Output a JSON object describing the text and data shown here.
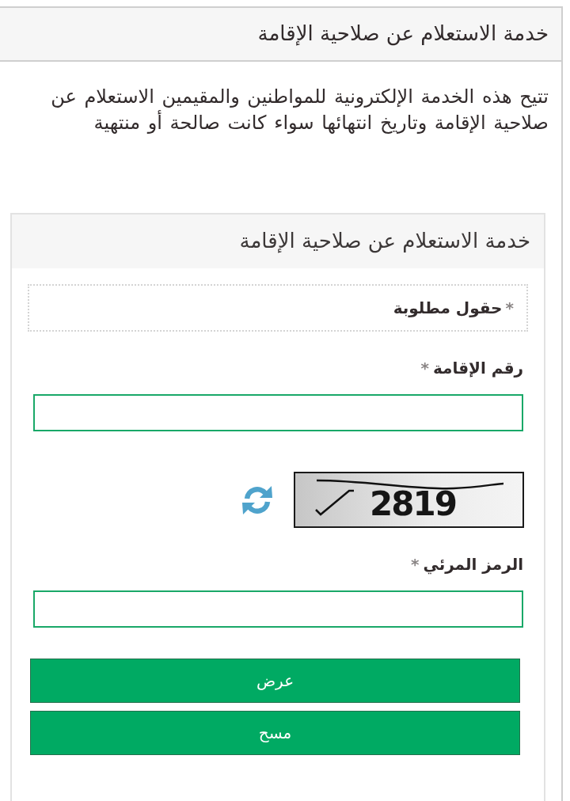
{
  "page_header": {
    "title": "خدمة الاستعلام عن صلاحية الإقامة"
  },
  "description": "تتيح هذه الخدمة الإلكترونية للمواطنين والمقيمين الاستعلام عن صلاحية الإقامة وتاريخ انتهائها سواء كانت صالحة أو منتهية",
  "form": {
    "title": "خدمة الاستعلام عن صلاحية الإقامة",
    "required_note": {
      "mark": "*",
      "text": "حقول مطلوبة"
    },
    "items": [
      {
        "kind": "input",
        "label": "رقم الإقامة",
        "mark": "*"
      },
      {
        "kind": "captcha",
        "code": "2819"
      },
      {
        "kind": "input",
        "label": "الرمز المرئي",
        "mark": "*"
      }
    ],
    "buttons": [
      {
        "label": "عرض"
      },
      {
        "label": "مسح"
      }
    ]
  }
}
